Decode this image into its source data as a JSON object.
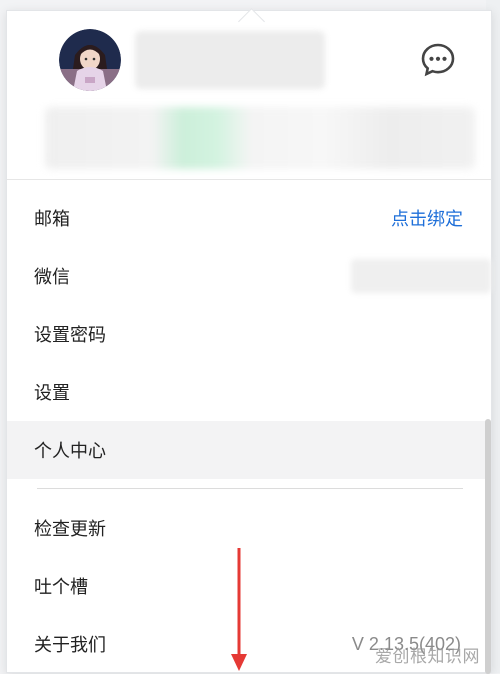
{
  "menu": {
    "items": [
      {
        "label": "邮箱",
        "right": "点击绑定"
      },
      {
        "label": "微信"
      },
      {
        "label": "设置密码"
      },
      {
        "label": "设置"
      },
      {
        "label": "个人中心"
      }
    ],
    "items2": [
      {
        "label": "检查更新"
      },
      {
        "label": "吐个槽"
      },
      {
        "label": "关于我们",
        "version": "V 2.13.5(402)"
      }
    ]
  },
  "icons": {
    "message": "chat-bubble-icon",
    "annotation": "red-down-arrow"
  },
  "colors": {
    "link": "#1e6fd9",
    "arrow": "#e53935",
    "highlight_row": "#f3f3f4"
  },
  "watermark": "爱创根知识网"
}
